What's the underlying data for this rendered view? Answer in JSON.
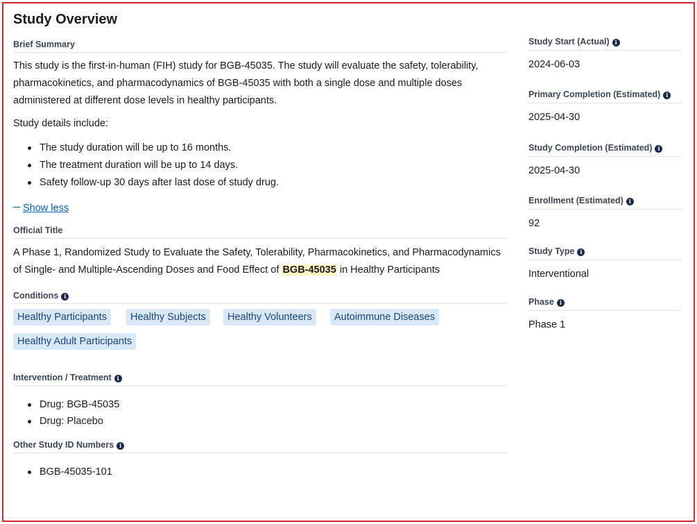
{
  "page_title": "Study Overview",
  "brief_summary": {
    "label": "Brief Summary",
    "paragraph": "This study is the first-in-human (FIH) study for BGB-45035. The study will evaluate the safety, tolerability, pharmacokinetics, and pharmacodynamics of BGB-45035 with both a single dose and multiple doses administered at different dose levels in healthy participants.",
    "details_intro": "Study details include:",
    "details": [
      "The study duration will be up to 16 months.",
      "The treatment duration will be up to 14 days.",
      "Safety follow-up 30 days after last dose of study drug."
    ],
    "toggle_label": "Show less"
  },
  "official_title": {
    "label": "Official Title",
    "before": "A Phase 1, Randomized Study to Evaluate the Safety, Tolerability, Pharmacokinetics, and Pharmacodynamics of Single- and Multiple-Ascending Doses and Food Effect of ",
    "highlight": "BGB-45035",
    "after": " in Healthy Participants"
  },
  "conditions": {
    "label": "Conditions",
    "items": [
      "Healthy Participants",
      "Healthy Subjects",
      "Healthy Volunteers",
      "Autoimmune Diseases",
      "Healthy Adult Participants"
    ]
  },
  "intervention": {
    "label": "Intervention / Treatment",
    "items": [
      "Drug: BGB-45035",
      "Drug: Placebo"
    ]
  },
  "other_ids": {
    "label": "Other Study ID Numbers",
    "items": [
      "BGB-45035-101"
    ]
  },
  "sidebar": [
    {
      "label": "Study Start (Actual)",
      "value": "2024-06-03"
    },
    {
      "label": "Primary Completion (Estimated)",
      "value": "2025-04-30"
    },
    {
      "label": "Study Completion (Estimated)",
      "value": "2025-04-30"
    },
    {
      "label": "Enrollment (Estimated)",
      "value": "92"
    },
    {
      "label": "Study Type",
      "value": "Interventional"
    },
    {
      "label": "Phase",
      "value": "Phase 1"
    }
  ],
  "icons": {
    "info": "info-icon",
    "minus": "minus-icon"
  },
  "colors": {
    "border": "#d7262d",
    "chip_bg": "#d9e8f6",
    "chip_text": "#1a4480",
    "link": "#005ea2",
    "highlight": "#fff5c2"
  }
}
